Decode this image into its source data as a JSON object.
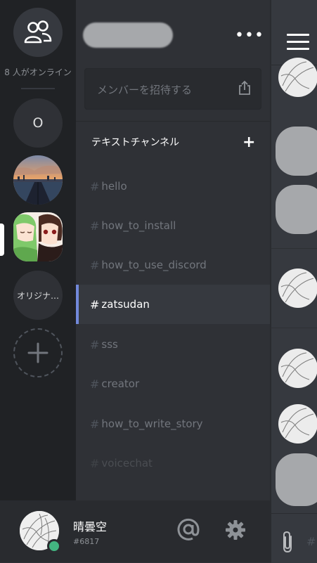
{
  "rail": {
    "online_text": "8 人がオンライン",
    "servers": [
      {
        "label": "O"
      },
      {
        "label": ""
      },
      {
        "label": ""
      },
      {
        "label": "オリジナ…"
      }
    ]
  },
  "panel": {
    "invite_placeholder": "メンバーを招待する",
    "category": "テキストチャンネル",
    "category_add": "+",
    "more": "•••",
    "channels": [
      {
        "name": "hello"
      },
      {
        "name": "how_to_install"
      },
      {
        "name": "how_to_use_discord"
      },
      {
        "name": "zatsudan"
      },
      {
        "name": "sss"
      },
      {
        "name": "creator"
      },
      {
        "name": "how_to_write_story"
      },
      {
        "name": "voicechat"
      }
    ]
  },
  "user": {
    "name": "晴曇空",
    "tag": "#6817"
  },
  "chat": {
    "input_hash": "#"
  },
  "colors": {
    "accent": "#7289da",
    "online": "#43b581",
    "rail_bg": "#202225",
    "panel_bg": "#2f3136"
  }
}
